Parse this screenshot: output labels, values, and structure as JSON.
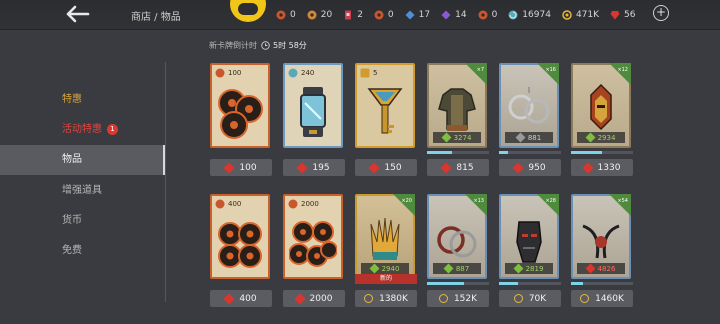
{
  "header": {
    "breadcrumb": "商店 / 物品",
    "currencies": [
      {
        "icon": "bronze-token-icon",
        "value": "0",
        "color": "#c9572b"
      },
      {
        "icon": "silver-token-icon",
        "value": "20",
        "color": "#d2893a"
      },
      {
        "icon": "card-ticket-icon",
        "value": "2",
        "color": "#c64050"
      },
      {
        "icon": "gold-token-icon",
        "value": "0",
        "color": "#c9572b"
      },
      {
        "icon": "blue-shard-icon",
        "value": "17",
        "color": "#4d8fd6"
      },
      {
        "icon": "purple-shard-icon",
        "value": "14",
        "color": "#8a5ad0"
      },
      {
        "icon": "orange-token-icon",
        "value": "0",
        "color": "#c9572b"
      },
      {
        "icon": "spiral-orb-icon",
        "value": "16974",
        "color": "#5aa8b8"
      },
      {
        "icon": "coin-icon",
        "value": "471K",
        "color": "#e8b83a"
      },
      {
        "icon": "ruby-gem-icon",
        "value": "56",
        "color": "#d8362e"
      }
    ]
  },
  "sidebar": {
    "items": [
      {
        "label": "特惠",
        "badge": ""
      },
      {
        "label": "活动特惠",
        "badge": "1"
      },
      {
        "label": "物品",
        "badge": ""
      },
      {
        "label": "增强道具",
        "badge": ""
      },
      {
        "label": "货币",
        "badge": ""
      },
      {
        "label": "免费",
        "badge": ""
      }
    ]
  },
  "timer": {
    "label": "新卡牌倒计时",
    "value": "5时 58分"
  },
  "row1": [
    {
      "qty": "100",
      "price": "100",
      "price_icon": "gem"
    },
    {
      "qty": "240",
      "price": "195",
      "price_icon": "gem"
    },
    {
      "qty": "5",
      "price": "150",
      "price_icon": "gem"
    },
    {
      "tag": "×7",
      "power": "3274",
      "progress": 0.4,
      "price": "815",
      "price_icon": "gem"
    },
    {
      "tag": "×16",
      "power": "881",
      "progress": 0.15,
      "price": "950",
      "price_icon": "gem"
    },
    {
      "tag": "×12",
      "power": "2934",
      "progress": 0.5,
      "price": "1330",
      "price_icon": "gem"
    }
  ],
  "row2": [
    {
      "qty": "400",
      "price": "400",
      "price_icon": "gem"
    },
    {
      "qty": "2000",
      "price": "2000",
      "price_icon": "gem"
    },
    {
      "tag": "×20",
      "power": "2940",
      "new_label": "新的",
      "price": "1380K",
      "price_icon": "coin"
    },
    {
      "tag": "×13",
      "power": "887",
      "progress": 0.6,
      "price": "152K",
      "price_icon": "coin"
    },
    {
      "tag": "×28",
      "power": "2819",
      "progress": 0.3,
      "price": "70K",
      "price_icon": "coin"
    },
    {
      "tag": "×54",
      "power": "4826",
      "progress": 0.2,
      "price": "1460K",
      "price_icon": "coin"
    }
  ]
}
